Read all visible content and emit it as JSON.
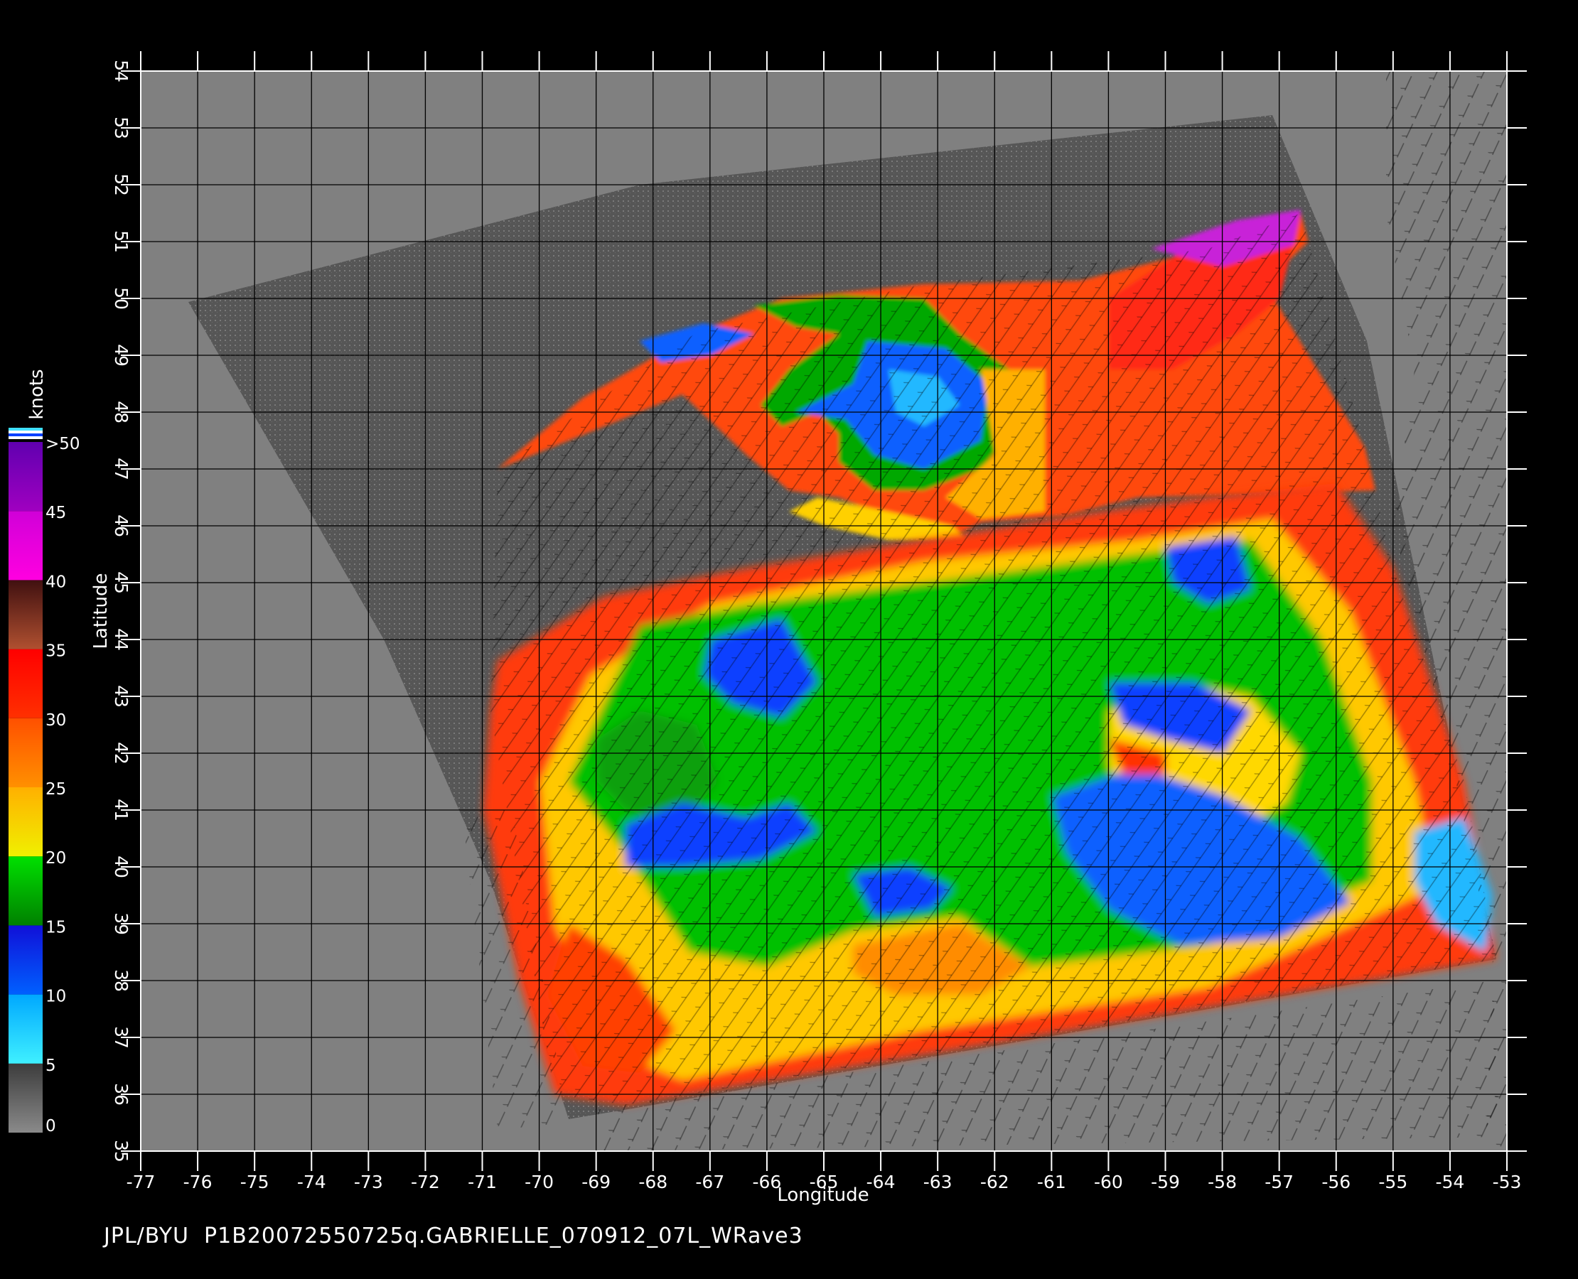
{
  "caption": "JPL/BYU  P1B20072550725q.GABRIELLE_070912_07L_WRave3",
  "map": {
    "xlabel": "Longitude",
    "ylabel": "Latitude",
    "lon_range": [
      -77,
      -53
    ],
    "lat_range": [
      35,
      54
    ],
    "lon_ticks": [
      "-77",
      "-76",
      "-75",
      "-74",
      "-73",
      "-72",
      "-71",
      "-70",
      "-69",
      "-68",
      "-67",
      "-66",
      "-65",
      "-64",
      "-63",
      "-62",
      "-61",
      "-60",
      "-59",
      "-58",
      "-57",
      "-56",
      "-55",
      "-54",
      "-53"
    ],
    "lat_ticks": [
      "35",
      "36",
      "37",
      "38",
      "39",
      "40",
      "41",
      "42",
      "43",
      "44",
      "45",
      "46",
      "47",
      "48",
      "49",
      "50",
      "51",
      "52",
      "53",
      "54"
    ],
    "grid": true,
    "background": "#808080",
    "swath_color": "#555555"
  },
  "colorbar": {
    "unit": "knots",
    "labels": [
      ">50",
      "45",
      "40",
      "35",
      "30",
      "25",
      "20",
      "15",
      "10",
      "5",
      "0"
    ],
    "bands": [
      {
        "from": 0,
        "to": 5,
        "colors": [
          "#8a8a8a",
          "#3c3c3c"
        ]
      },
      {
        "from": 5,
        "to": 10,
        "colors": [
          "#3ff0ff",
          "#00a8ff"
        ]
      },
      {
        "from": 10,
        "to": 15,
        "colors": [
          "#0060ff",
          "#1010d8"
        ]
      },
      {
        "from": 15,
        "to": 20,
        "colors": [
          "#008000",
          "#00e000"
        ]
      },
      {
        "from": 20,
        "to": 25,
        "colors": [
          "#f0f000",
          "#ffb000"
        ]
      },
      {
        "from": 25,
        "to": 30,
        "colors": [
          "#ff9000",
          "#ff5000"
        ]
      },
      {
        "from": 30,
        "to": 35,
        "colors": [
          "#ff3000",
          "#ff0000"
        ]
      },
      {
        "from": 35,
        "to": 40,
        "colors": [
          "#b05030",
          "#401010"
        ]
      },
      {
        "from": 40,
        "to": 45,
        "colors": [
          "#ff00e0",
          "#d000d8"
        ]
      },
      {
        "from": 45,
        "to": 50,
        "colors": [
          "#a000c0",
          "#6000b0"
        ]
      }
    ]
  }
}
